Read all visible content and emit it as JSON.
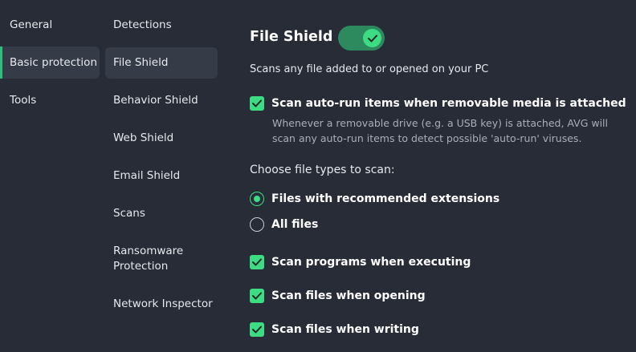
{
  "nav_primary": {
    "items": [
      {
        "label": "General"
      },
      {
        "label": "Basic protection",
        "active": true
      },
      {
        "label": "Tools"
      }
    ]
  },
  "nav_secondary": {
    "items": [
      {
        "label": "Detections"
      },
      {
        "label": "File Shield",
        "active": true
      },
      {
        "label": "Behavior Shield"
      },
      {
        "label": "Web Shield"
      },
      {
        "label": "Email Shield"
      },
      {
        "label": "Scans"
      },
      {
        "label": "Ransomware Protection"
      },
      {
        "label": "Network Inspector"
      }
    ]
  },
  "content": {
    "title": "File Shield",
    "toggle_on": true,
    "description": "Scans any file added to or opened on your PC",
    "autorun": {
      "label": "Scan auto-run items when removable media is attached",
      "checked": true,
      "sub": "Whenever a removable drive (e.g. a USB key) is attached, AVG will scan any auto-run items to detect possible 'auto-run' viruses."
    },
    "file_types_label": "Choose file types to scan:",
    "file_types": [
      {
        "label": "Files with recommended extensions",
        "selected": true
      },
      {
        "label": "All files",
        "selected": false
      }
    ],
    "options": [
      {
        "label": "Scan programs when executing",
        "checked": true
      },
      {
        "label": "Scan files when opening",
        "checked": true
      },
      {
        "label": "Scan files when writing",
        "checked": true
      }
    ]
  },
  "colors": {
    "background": "#272c36",
    "accent": "#3ddc84",
    "active_item": "#353b47"
  }
}
